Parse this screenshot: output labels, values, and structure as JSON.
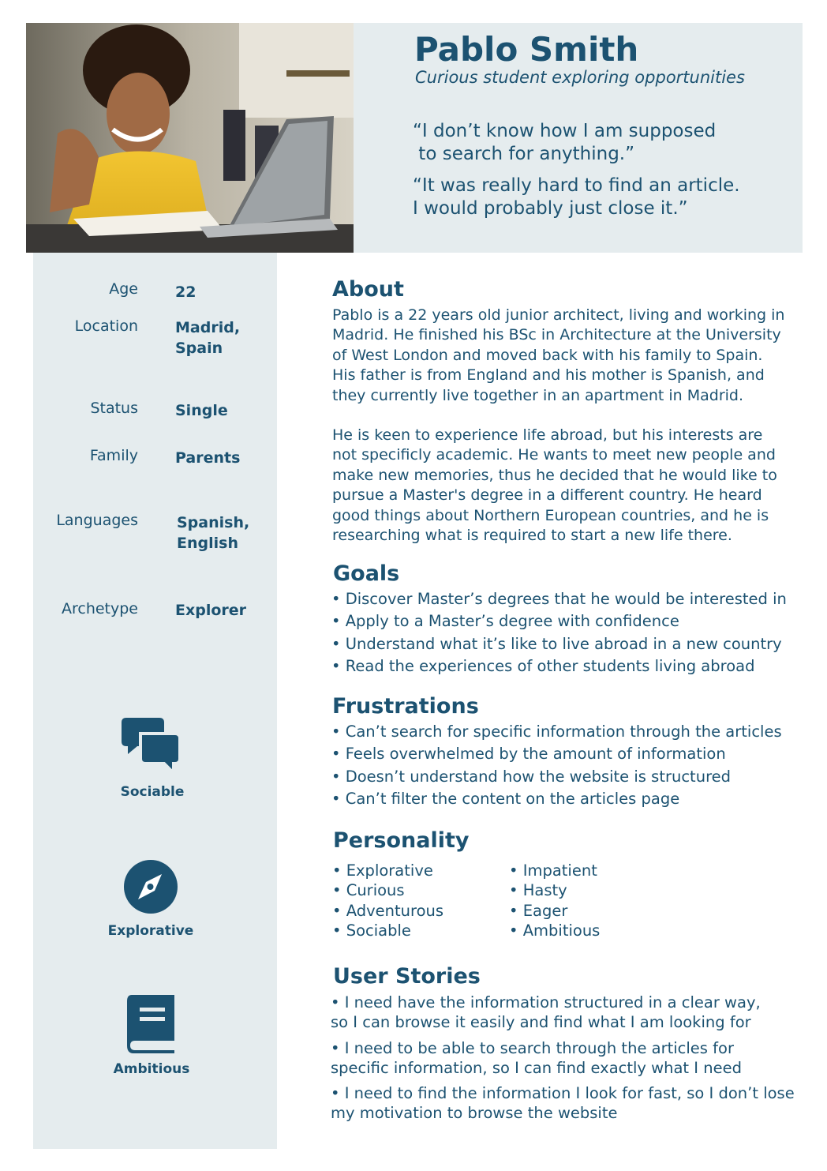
{
  "header": {
    "name": "Pablo Smith",
    "tagline": "Curious student exploring opportunities",
    "quotes": [
      "“I don’t know how I am supposed\n to search for anything.”",
      "“It was really hard to find an article.\nI would probably just close it.”"
    ]
  },
  "facts": [
    {
      "label": "Age",
      "value": "22"
    },
    {
      "label": "Location",
      "value": "Madrid,\nSpain"
    },
    {
      "label": "Status",
      "value": "Single"
    },
    {
      "label": "Family",
      "value": "Parents"
    },
    {
      "label": "Languages",
      "value": "Spanish,\nEnglish"
    },
    {
      "label": "Archetype",
      "value": "Explorer"
    }
  ],
  "traits": [
    {
      "label": "Sociable",
      "icon": "chat-bubbles-icon"
    },
    {
      "label": "Explorative",
      "icon": "compass-icon"
    },
    {
      "label": "Ambitious",
      "icon": "book-icon"
    }
  ],
  "about": {
    "title": "About",
    "paragraphs": [
      "Pablo is a 22 years old junior architect, living and working in\nMadrid. He finished his BSc in Architecture at the University\nof West London and moved back with his family to Spain.\nHis father is from England and his mother is Spanish, and\nthey currently live together in an apartment in Madrid.",
      "He is keen to experience life abroad, but his interests are\nnot specificly academic. He wants to meet new people and\nmake new memories, thus he decided that he would like to\npursue a Master's degree in a different country. He heard\ngood things about Northern European countries, and he is\nresearching what is required to start a new life there."
    ]
  },
  "goals": {
    "title": "Goals",
    "items": [
      "• Discover Master’s degrees that he would be interested in",
      "• Apply to a Master’s degree with confidence",
      "• Understand what it’s like to live abroad in a new country",
      "• Read the experiences of other students living abroad"
    ]
  },
  "frustrations": {
    "title": "Frustrations",
    "items": [
      "• Can’t search for specific information through the articles",
      "• Feels overwhelmed by the amount of information",
      "• Doesn’t understand how the website is structured",
      "• Can’t filter the content on the articles page"
    ]
  },
  "personality": {
    "title": "Personality",
    "left": [
      "• Explorative",
      "• Curious",
      "• Adventurous",
      "• Sociable"
    ],
    "right": [
      "• Impatient",
      "• Hasty",
      "• Eager",
      "• Ambitious"
    ]
  },
  "user_stories": {
    "title": "User Stories",
    "items": [
      "• I need have the information structured in a clear way,\nso I can browse it easily and find what I am looking for",
      "• I need to be able to search through the articles for\nspecific information, so I can find exactly what I need",
      "• I need to find the information I look for fast, so I don’t lose\nmy motivation to browse the website"
    ]
  },
  "colors": {
    "primary": "#1c5271",
    "panel": "#e5ecee",
    "background": "#ffffff"
  }
}
